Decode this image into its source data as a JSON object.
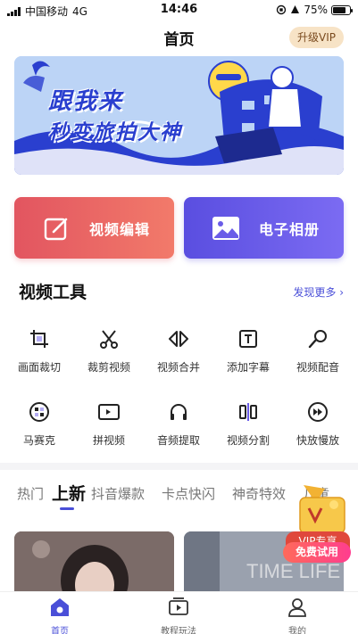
{
  "status_bar": {
    "carrier": "中国移动",
    "network": "4G",
    "time": "14:46",
    "battery": "75%",
    "battery_level": 0.75
  },
  "header": {
    "title": "首页",
    "vip_label": "升级VIP"
  },
  "banner": {
    "line1": "跟我来",
    "line2": "秒变旅拍大神"
  },
  "actions": [
    {
      "label": "视频编辑",
      "icon": "edit-icon"
    },
    {
      "label": "电子相册",
      "icon": "image-icon"
    }
  ],
  "tools_section": {
    "title": "视频工具",
    "more_label": "发现更多 ›",
    "tools": [
      {
        "label": "画面裁切",
        "icon": "crop-icon"
      },
      {
        "label": "裁剪视频",
        "icon": "scissors-icon"
      },
      {
        "label": "视频合并",
        "icon": "merge-icon"
      },
      {
        "label": "添加字幕",
        "icon": "subtitle-icon"
      },
      {
        "label": "视频配音",
        "icon": "microphone-icon"
      },
      {
        "label": "马赛克",
        "icon": "mosaic-icon"
      },
      {
        "label": "拼视频",
        "icon": "collage-icon"
      },
      {
        "label": "音频提取",
        "icon": "headphones-icon"
      },
      {
        "label": "视频分割",
        "icon": "split-icon"
      },
      {
        "label": "快放慢放",
        "icon": "speed-icon"
      }
    ]
  },
  "category_tabs": [
    "热门",
    "上新",
    "抖音爆款",
    "卡点快闪",
    "神奇特效",
    "儿童"
  ],
  "active_tab_index": 1,
  "vip_promo": {
    "label": "VIP专享",
    "button": "免费试用"
  },
  "bottom_nav": [
    {
      "label": "首页",
      "icon": "home-icon"
    },
    {
      "label": "教程玩法",
      "icon": "play-tutorial-icon"
    },
    {
      "label": "我的",
      "icon": "profile-icon"
    }
  ],
  "colors": {
    "accent": "#4a4fd8",
    "edit_button": "#e25560",
    "album_button": "#5a4ee0",
    "vip_gold": "#f7e3c6",
    "promo_red": "#e0483c"
  }
}
